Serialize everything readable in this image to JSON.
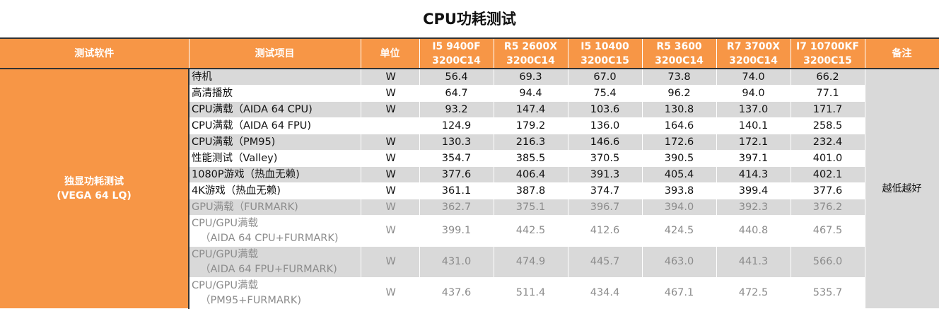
{
  "title": "CPU功耗测试",
  "headers": {
    "software": "测试软件",
    "item": "测试项目",
    "unit": "单位",
    "cpus": [
      {
        "line1": "I5 9400F",
        "line2": "3200C14"
      },
      {
        "line1": "R5 2600X",
        "line2": "3200C14"
      },
      {
        "line1": "I5 10400",
        "line2": "3200C15"
      },
      {
        "line1": "R5 3600",
        "line2": "3200C14"
      },
      {
        "line1": "R7 3700X",
        "line2": "3200C14"
      },
      {
        "line1": "I7 10700KF",
        "line2": "3200C15"
      }
    ],
    "note": "备注"
  },
  "software": {
    "line1": "独显功耗测试",
    "line2": "(VEGA 64 LQ)"
  },
  "note": "越低越好",
  "rows": [
    {
      "item": "待机",
      "item2": "",
      "unit": "W",
      "values": [
        "56.4",
        "69.3",
        "67.0",
        "73.8",
        "74.0",
        "66.2"
      ]
    },
    {
      "item": "高清播放",
      "item2": "",
      "unit": "W",
      "values": [
        "64.7",
        "94.4",
        "75.4",
        "96.2",
        "94.0",
        "77.1"
      ]
    },
    {
      "item": "CPU满载（AIDA 64 CPU)",
      "item2": "",
      "unit": "W",
      "values": [
        "93.2",
        "147.4",
        "103.6",
        "130.8",
        "137.0",
        "171.7"
      ]
    },
    {
      "item": "CPU满载（AIDA 64 FPU)",
      "item2": "",
      "unit": "",
      "values": [
        "124.9",
        "179.2",
        "136.0",
        "164.6",
        "140.1",
        "258.5"
      ]
    },
    {
      "item": "CPU满载（PM95)",
      "item2": "",
      "unit": "W",
      "values": [
        "130.3",
        "216.3",
        "146.6",
        "172.6",
        "172.1",
        "232.4"
      ]
    },
    {
      "item": "性能测试（Valley)",
      "item2": "",
      "unit": "W",
      "values": [
        "354.7",
        "385.5",
        "370.5",
        "390.5",
        "397.1",
        "401.0"
      ]
    },
    {
      "item": "1080P游戏（热血无赖)",
      "item2": "",
      "unit": "W",
      "values": [
        "377.6",
        "406.4",
        "391.3",
        "405.4",
        "414.3",
        "402.1"
      ]
    },
    {
      "item": "4K游戏（热血无赖)",
      "item2": "",
      "unit": "W",
      "values": [
        "361.1",
        "387.8",
        "374.7",
        "393.8",
        "399.4",
        "377.6"
      ]
    },
    {
      "item": "GPU满载（FURMARK)",
      "item2": "",
      "unit": "W",
      "values": [
        "362.7",
        "375.1",
        "396.7",
        "394.0",
        "392.3",
        "376.2"
      ]
    },
    {
      "item": "CPU/GPU满载",
      "item2": "（AIDA 64 CPU+FURMARK)",
      "unit": "W",
      "values": [
        "399.1",
        "442.5",
        "412.6",
        "424.5",
        "440.8",
        "467.5"
      ]
    },
    {
      "item": "CPU/GPU满载",
      "item2": "（AIDA 64 FPU+FURMARK)",
      "unit": "W",
      "values": [
        "431.0",
        "474.9",
        "445.7",
        "463.0",
        "441.3",
        "566.0"
      ]
    },
    {
      "item": "CPU/GPU满载",
      "item2": "（PM95+FURMARK)",
      "unit": "W",
      "values": [
        "437.6",
        "511.4",
        "434.4",
        "467.1",
        "472.5",
        "535.7"
      ]
    }
  ]
}
